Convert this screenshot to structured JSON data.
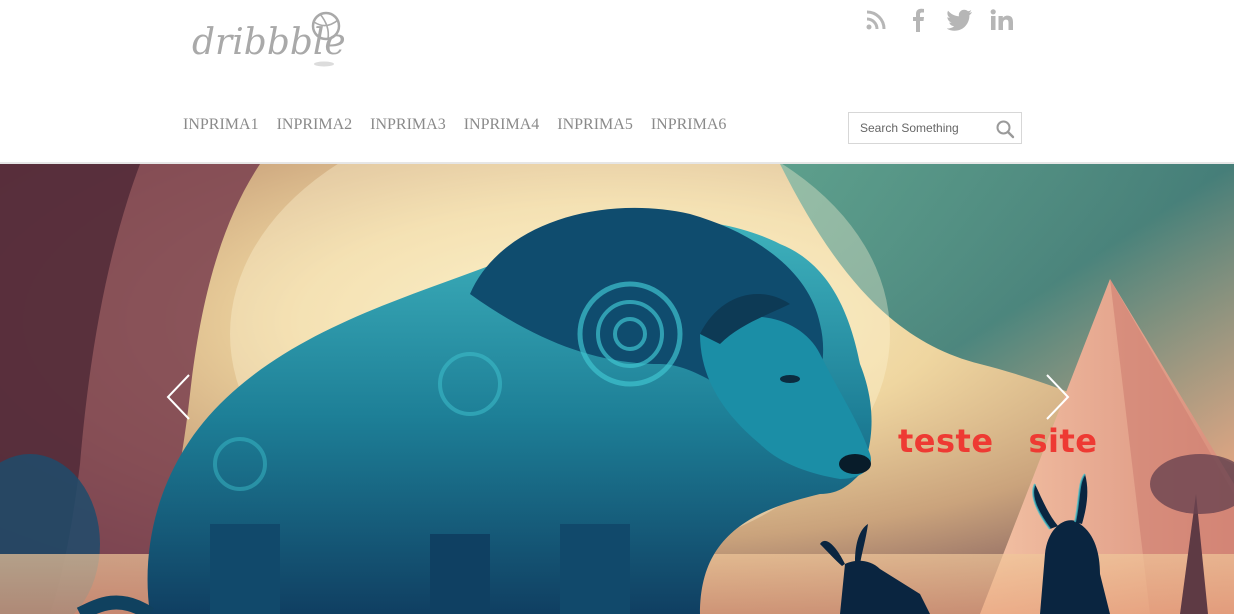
{
  "brand": {
    "logo_text": "dribbble"
  },
  "social": [
    {
      "icon": "rss-icon"
    },
    {
      "icon": "facebook-icon"
    },
    {
      "icon": "twitter-icon"
    },
    {
      "icon": "linkedin-icon"
    }
  ],
  "nav": {
    "items": [
      "INPRIMA1",
      "INPRIMA2",
      "INPRIMA3",
      "INPRIMA4",
      "INPRIMA5",
      "INPRIMA6"
    ]
  },
  "search": {
    "placeholder": "Search Something"
  },
  "slider": {
    "caption": "teste   site",
    "caption_color": "#ee3a33"
  },
  "colors": {
    "nav_text": "#8a8a8a",
    "icon_gray": "#b6b6b6",
    "accent_red": "#ee3a33"
  }
}
